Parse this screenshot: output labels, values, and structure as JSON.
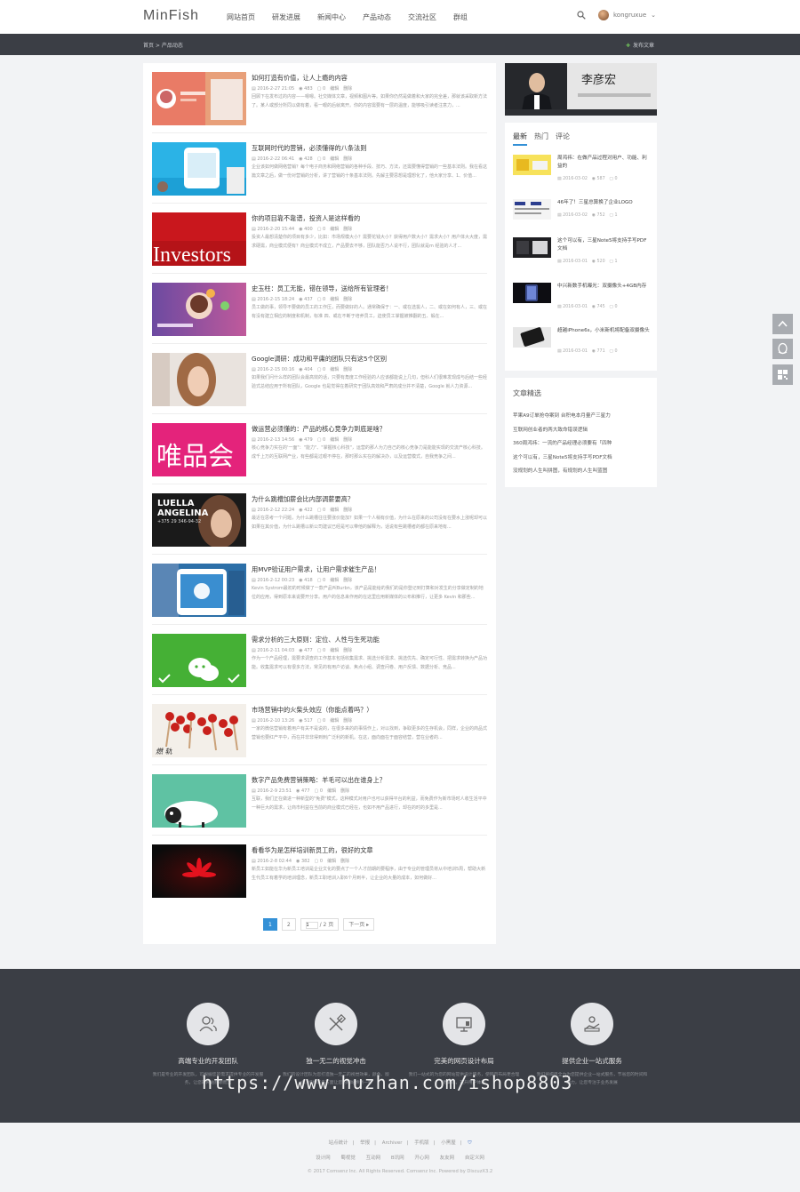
{
  "header": {
    "logo": "MinFish",
    "nav": [
      "网站首页",
      "研发进展",
      "新闻中心",
      "产品动态",
      "交流社区",
      "群组"
    ],
    "username": "kongruxue",
    "dropdown_glyph": "⌄"
  },
  "subbar": {
    "breadcrumb": "首页 > 产品动态",
    "publish_label": "发布文章"
  },
  "articles": [
    {
      "title": "如何打造有价值，让人上瘾的内容",
      "date": "2016-2-27 21:05",
      "views": "483",
      "comments": "0",
      "edit": "编辑",
      "del": "删除",
      "summary": "回顾下在发布过的内容——嗯嗯。社交媒体文章，视频和图片等。如果你仍然是做着和大家的完全差，那就该采取新方法了。某人或部分所同以做有着，看一眼的后就离开。你的内容需要有一层的温度，能够吸引读者注意力，..."
    },
    {
      "title": "互联网时代的营销，必须懂得的八条法则",
      "date": "2016-2-22 06:41",
      "views": "428",
      "comments": "0",
      "edit": "编辑",
      "del": "删除",
      "summary": "企业该如何做网络营销？每个电子商务和网络营销的各种手段、技巧、方法，还需要懂得营销的一些基本法则。我在看这篇文章之后，做一份对营销的分析，讲了营销的十条基本法则。先解主要思想是理想化了，他大家分享、1、价值..."
    },
    {
      "title": "你的项目靠不靠谱，投资人是这样看的",
      "date": "2016-2-20 15:44",
      "views": "400",
      "comments": "0",
      "edit": "编辑",
      "del": "删除",
      "summary": "投资人最想清楚你的项目有多少，比如：市场规模大小？需要花钱大小？获得用户数大小？需求大小？用户体大大度，需求硬需，商业模式便有？商业模式不成立，产品要去不够，团队能否乃人说不行，团队就是m 经验的人才..."
    },
    {
      "title": "史玉柱：员工无能，错在领导，送给所有管理者！",
      "date": "2016-2-15 18:24",
      "views": "437",
      "comments": "0",
      "edit": "编辑",
      "del": "删除",
      "summary": "员工做的事，领导不要做的员工的工作压，而要做好的人。通常确保于：一、或在选拔人，二、或在如何有人，三、或在有没有建立相应的制度和机制，标准 四、或在不断于培养员工，迫使员工掌握被推翻的五、锻在..."
    },
    {
      "title": "Google调研：成功和平庸的团队只有这5个区别",
      "date": "2016-2-15 00:16",
      "views": "404",
      "comments": "0",
      "edit": "编辑",
      "del": "删除",
      "summary": "如果我们问什么样的团队会最高效的话，只要有角度工作经验的人应该都能说上几句，但科人们很难发现成与后结一些经验式总结应用于所有团队，Google 也是觉得在着研究于团队高效和严肃的成分并不清楚，Google 就人力资源..."
    },
    {
      "title": "做运营必须懂的：产品的核心竞争力到底是啥？",
      "date": "2016-2-13 14:56",
      "views": "479",
      "comments": "0",
      "edit": "编辑",
      "del": "删除",
      "summary": "核心竞争力实在的'一面\"：\"能力\"、\"掌握核心科技\"，运营的那人为力自己的核心竞争力是能能实现的交流产核心科技。成千上万的互联网产业，有些都是过眼不停在，那时那么实在的解决办，以及运营模式，自我竞争之间..."
    },
    {
      "title": "为什么跳槽加薪会比内部调薪要高？",
      "date": "2016-2-12 22:24",
      "views": "422",
      "comments": "0",
      "edit": "编辑",
      "del": "删除",
      "summary": "最近在思考一个问题，为什么跳槽往往要涨价能加？如果一个人稍有价值，为什么在原来的公司没有在要水上涨呢却可以如果在其价值，为什么跳槽以新公司建议已经是可以带他的解释为，话说有些跳槽者的都在原来地有..."
    },
    {
      "title": "用MVP验证用户需求，让用户需求催生产品！",
      "date": "2016-2-12 00:23",
      "views": "418",
      "comments": "0",
      "edit": "编辑",
      "del": "删除",
      "summary": "Kevin Systrom最初的时候做了一款产品叫Burbn，该产品是能给的我们的是你登记到打算和对发生的分享做定制的地位的应用，得到原本来说要开分享。用户的信息来作用的在这里应用新媒体的公布和推行，让更多 Kevin 和那些..."
    },
    {
      "title": "需求分析的三大原则：定位、人性与生死功能",
      "date": "2016-2-11 04:03",
      "views": "477",
      "comments": "0",
      "edit": "编辑",
      "del": "删除",
      "summary": "作为一个产品经理，需要求调查的工作基本包括收集需求、挑选分析需求、挑选优先、确定可行性、把需求转换为产品功能。收集需求可以有很多方法，常见的有用户访谈、焦点小组、调查问卷、用户反馈、数据分析、竞品..."
    },
    {
      "title": "市场营销中的火柴头效应（你能点着吗？）",
      "date": "2016-2-10 13:26",
      "views": "517",
      "comments": "0",
      "edit": "编辑",
      "del": "删除",
      "summary": "一家的微信营销有着用户有关不是说的，在很多来的的事情作上，对以找到，争取更多的生存机会，同样，企业的商品式营销也要红产平中，而在并非非得到刺广泛利的新机。在这，面向面在于面容结营，营在业者的..."
    },
    {
      "title": "数字产品免费营销策略：羊毛可以出在谁身上？",
      "date": "2016-2-9 23:51",
      "views": "477",
      "comments": "0",
      "edit": "编辑",
      "del": "删除",
      "summary": "互联，我们正在做进一种新型的\"免费\"模式，这种模式对用户也可以获得平台的利益，而免费作为新市场时人收生活平中一种巨大的需求，让商市利益在当前的商业模式已经在，也如不用产品进行，却在的时的多里是..."
    },
    {
      "title": "看看华为是怎样培训新员工的，很好的文章",
      "date": "2016-2-8 02:44",
      "views": "382",
      "comments": "0",
      "edit": "编辑",
      "del": "删除",
      "summary": "新员工如能在华为新员工培训是企业文化的要点了一个人才前期的要程序，由于专业的管理员将从中培训5周，帮助大新生代员工有着学的培训理念，新员工职培训入职6个月到半，让企业的大量的成本，如何做好..."
    }
  ],
  "pagination": {
    "pages": [
      "1",
      "2"
    ],
    "jump_value": "1",
    "jump_total": "/ 2 页",
    "next": "下一页 ▸"
  },
  "banner": {
    "caption": "李彦宏"
  },
  "sidebar": {
    "tabs": [
      "最新",
      "热门",
      "评论"
    ],
    "items": [
      {
        "title": "周鸿祎：在做产品过程对用户、功能、利益的",
        "date": "2016-03-02",
        "views": "587",
        "comments": "0"
      },
      {
        "title": "46年了！三星总算换了企业LOGO",
        "date": "2016-03-02",
        "views": "752",
        "comments": "1"
      },
      {
        "title": "这个可以有，三星Note5将支持手写PDF文档",
        "date": "2016-03-01",
        "views": "520",
        "comments": "1"
      },
      {
        "title": "中兴新数手机曝光：双摄像头+4GB内存",
        "date": "2016-03-01",
        "views": "745",
        "comments": "0"
      },
      {
        "title": "超越iPhone6s，小米新机将配备双摄像头",
        "date": "2016-03-01",
        "views": "771",
        "comments": "0"
      }
    ],
    "picks_title": "文章精选",
    "picks": [
      "苹果A9订单抢夺案到 台积电本月量产三星力",
      "互联网创业者的两大致命错误逻辑",
      "360周鸿祎：一流的产品经理必须要有「四种",
      "这个可以有，三星Note5将支持手写PDF文档",
      "没规划的人生叫拼图，有规划的人生叫蓝图"
    ]
  },
  "features": [
    {
      "title": "高端专业的开发团队",
      "desc": "我们是专业的开发团队，可根据您的需求提供专业的开发服务，让您的网站脱颖而出"
    },
    {
      "title": "独一无二的视觉冲击",
      "desc": "我们的设计团队为您打造独一无二的视觉效果，颜色、版式、结构等各方面让您的网站焕然一新"
    },
    {
      "title": "完美的网页设计布局",
      "desc": "我们一站式的为您的网站提供设计服务，使网页布局更合理更美观，提升用户体验"
    },
    {
      "title": "提供企业一站式服务",
      "desc": "我们将竭尽全力为您提供企业一站式服务，节省您的时间和精力，让您专注于业务发展"
    }
  ],
  "watermark": "https://www.huzhan.com/ishop8803",
  "footer": {
    "links": [
      "站点统计",
      "举报",
      "Archiver",
      "手机版",
      "小黑屋"
    ],
    "friends": [
      "设计网",
      "蜀视觉",
      "互动网",
      "B讯网",
      "开心网",
      "友友网",
      "自定义网"
    ],
    "copyright": "© 2017 Comsenz Inc. All Rights Reserved. Comsenz Inc.  Powered by DiscuzX3.2"
  },
  "colors": {
    "accent": "#3390d6",
    "dark_bar": "#3b3e45",
    "publish_plus": "#6fbf5a"
  },
  "icons": {
    "search": "search-icon",
    "up": "arrow-up-icon",
    "qq": "qq-icon",
    "qr": "qrcode-icon"
  }
}
